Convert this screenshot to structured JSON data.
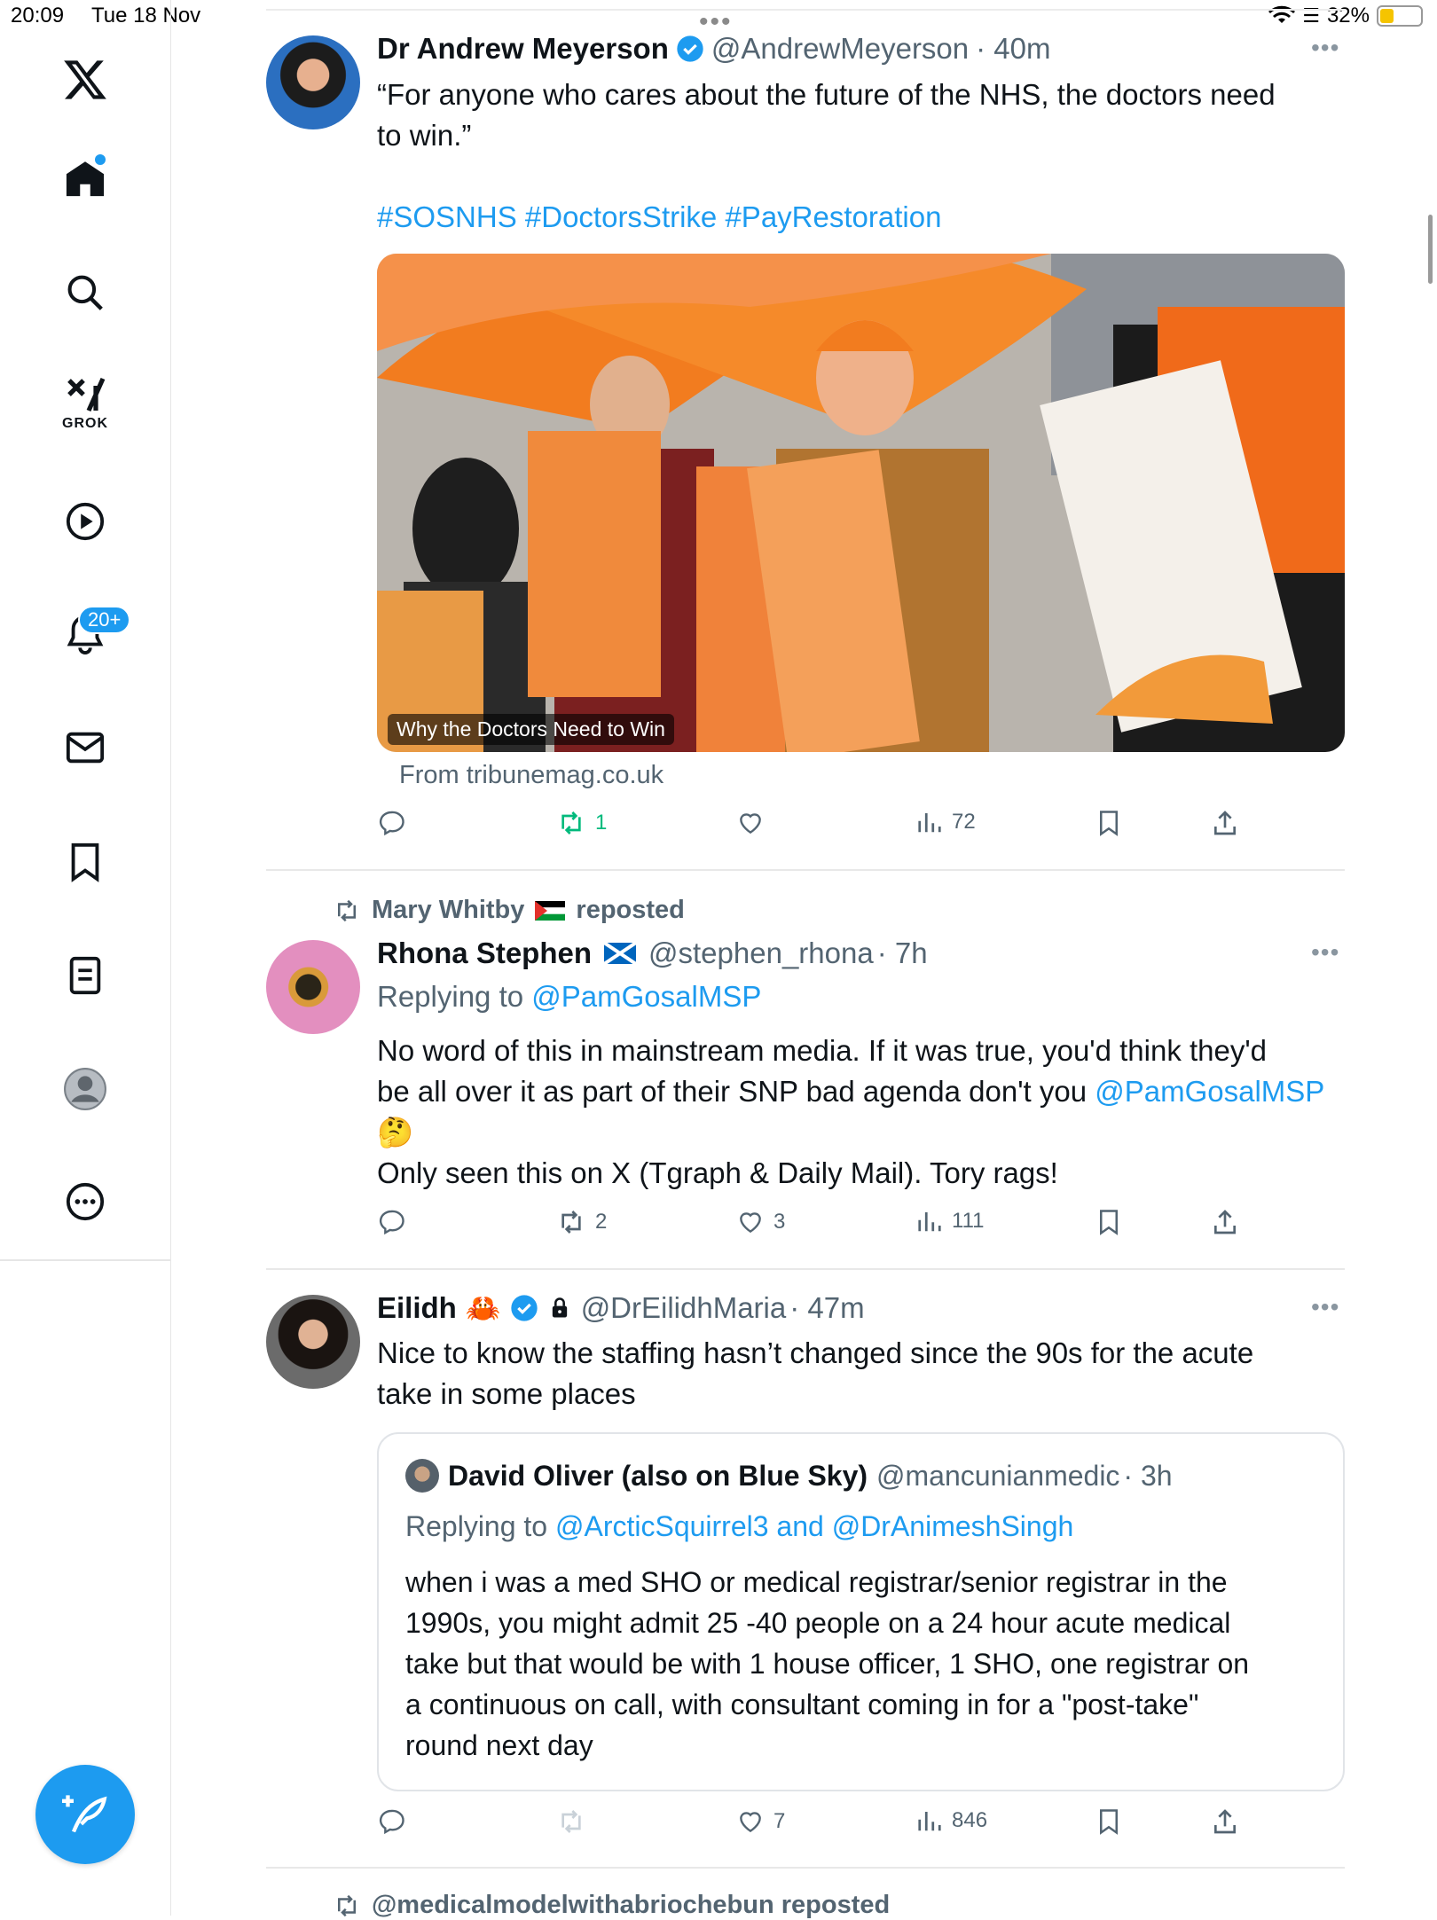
{
  "status_bar": {
    "time": "20:09",
    "date": "Tue 18 Nov",
    "battery": "32%"
  },
  "sidebar": {
    "notifications_badge": "20+",
    "grok_label": "GROK",
    "icons": [
      "x-logo-icon",
      "home-icon",
      "search-icon",
      "grok-icon",
      "video-icon",
      "bell-icon",
      "mail-icon",
      "bookmark-icon",
      "list-icon",
      "profile-icon",
      "more-icon",
      "compose-icon"
    ]
  },
  "tweets": [
    {
      "name": "Dr Andrew Meyerson",
      "verified": true,
      "handle": "@AndrewMeyerson",
      "time": "· 40m",
      "text_line1": "“For anyone who cares about the future of the NHS, the doctors need",
      "text_line2": "to win.”",
      "hashtags": "#SOSNHS #DoctorsStrike #PayRestoration",
      "card_title": "Why the Doctors Need to Win",
      "card_source": "From tribunemag.co.uk",
      "retweets": "1",
      "views": "72"
    },
    {
      "repost_by": "Mary Whitby",
      "repost_label": "reposted",
      "name": "Rhona Stephen",
      "handle": "@stephen_rhona",
      "time": "· 7h",
      "replying_prefix": "Replying to",
      "replying_to": "@PamGosalMSP",
      "text_line1": "No word of this in mainstream media. If it was true, you'd think they'd",
      "text_line2": "be all over it as part of their SNP bad agenda don't you",
      "text_mention": "@PamGosalMSP",
      "text_emoji": "🤔",
      "text_line4": "Only seen this on X (Tgraph & Daily Mail). Tory rags!",
      "retweets": "2",
      "likes": "3",
      "views": "111"
    },
    {
      "name": "Eilidh",
      "handle": "@DrEilidhMaria",
      "time": "· 47m",
      "text_line1": "Nice to know the staffing hasn’t changed since the 90s for the acute",
      "text_line2": "take in some places",
      "quote": {
        "name": "David Oliver (also on Blue Sky)",
        "handle": "@mancunianmedic",
        "time": "· 3h",
        "replying_prefix": "Replying to",
        "replying_to": "@ArcticSquirrel3 and @DrAnimeshSingh",
        "line1": "when i was a med SHO or medical registrar/senior registrar in the",
        "line2": "1990s, you might admit 25 -40 people on a 24 hour acute medical",
        "line3": "take but that would be with 1 house officer, 1 SHO, one registrar on",
        "line4": "a continuous on call, with consultant coming in for a \"post-take\"",
        "line5": "round next day"
      },
      "likes": "7",
      "views": "846"
    }
  ],
  "next_repost": "@medicalmodelwithabriochebun reposted",
  "colors": {
    "accent": "#1d9bf0",
    "retweet_green": "#00ba7c",
    "secondary_text": "#536471"
  }
}
